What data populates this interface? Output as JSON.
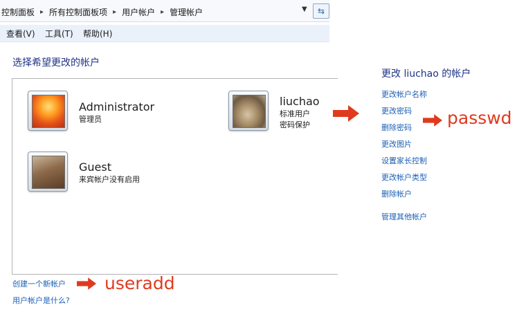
{
  "breadcrumb": [
    "控制面板",
    "所有控制面板项",
    "用户帐户",
    "管理帐户"
  ],
  "menu": [
    "查看(V)",
    "工具(T)",
    "帮助(H)"
  ],
  "heading": "选择希望更改的帐户",
  "accounts": [
    {
      "name": "Administrator",
      "lines": [
        "管理员"
      ]
    },
    {
      "name": "liuchao",
      "lines": [
        "标准用户",
        "密码保护"
      ]
    },
    {
      "name": "Guest",
      "lines": [
        "来宾帐户没有启用"
      ]
    }
  ],
  "bottom_links": [
    "创建一个新帐户",
    "用户帐户是什么?"
  ],
  "right": {
    "title": "更改 liuchao 的帐户",
    "links": [
      "更改帐户名称",
      "更改密码",
      "删除密码",
      "更改图片",
      "设置家长控制",
      "更改帐户类型",
      "删除帐户"
    ],
    "other": "管理其他帐户"
  },
  "annotations": {
    "passwd": "passwd",
    "useradd": "useradd"
  },
  "colors": {
    "link": "#1b5fb4",
    "heading": "#1e3287",
    "annotation": "#e03a1e"
  }
}
